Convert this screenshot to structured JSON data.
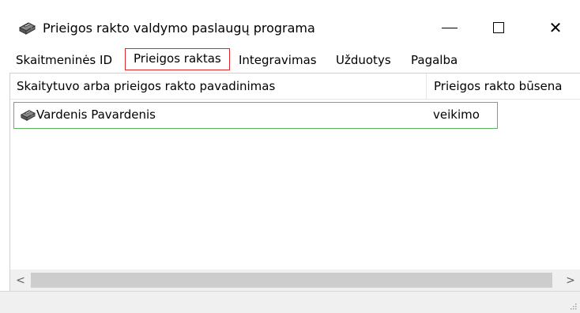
{
  "window": {
    "title": "Prieigos rakto valdymo paslaugų programa",
    "app_icon": "printer-icon",
    "controls": {
      "minimize": "minimize-icon",
      "maximize": "maximize-icon",
      "close_glyph": "✕"
    }
  },
  "menu": {
    "items": [
      {
        "label": "Skaitmeninės ID"
      },
      {
        "label": "Prieigos raktas",
        "highlighted": true
      },
      {
        "label": "Integravimas"
      },
      {
        "label": "Užduotys"
      },
      {
        "label": "Pagalba"
      }
    ],
    "highlight_color": "#e0252b"
  },
  "list": {
    "columns": [
      {
        "label": "Skaitytuvo arba prieigos rakto pavadinimas"
      },
      {
        "label": "Prieigos rakto būsena"
      }
    ],
    "rows": [
      {
        "icon": "printer-icon",
        "name": "Vardenis Pavardenis",
        "status": "veikimo",
        "highlighted": true
      }
    ],
    "row_highlight_color": "#5cb85c"
  },
  "scrollbar": {
    "left_arrow": "<",
    "right_arrow": ">"
  }
}
